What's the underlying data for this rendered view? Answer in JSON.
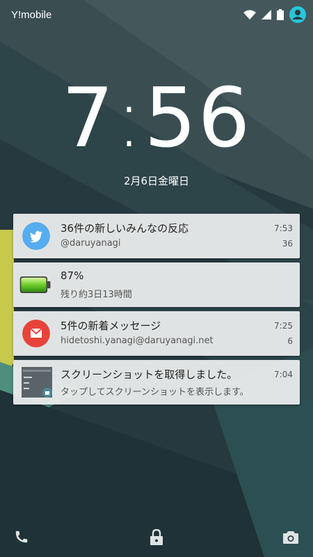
{
  "status": {
    "carrier": "Y!mobile"
  },
  "clock": {
    "hour": "7",
    "minute": "56"
  },
  "date": "2月6日金曜日",
  "notifications": [
    {
      "app": "twitter",
      "title": "36件の新しいみんなの反応",
      "text": "@daruyanagi",
      "time": "7:53",
      "count": "36",
      "color": "#55acee"
    },
    {
      "app": "battery",
      "title": "87%",
      "text": "残り約3日13時間",
      "time": "",
      "count": ""
    },
    {
      "app": "gmail",
      "title": "5件の新着メッセージ",
      "text": "hidetoshi.yanagi@daruyanagi.net",
      "time": "7:25",
      "count": "6",
      "color": "#e8433a"
    },
    {
      "app": "screenshot",
      "title": "スクリーンショットを取得しました。",
      "text": "タップしてスクリーンショットを表示します。",
      "time": "7:04",
      "count": ""
    }
  ],
  "bottom_actions": [
    "phone-icon",
    "lock-icon",
    "camera-icon"
  ],
  "colors": {
    "accent": "#26c6da",
    "wallpaper": "#263a40"
  }
}
